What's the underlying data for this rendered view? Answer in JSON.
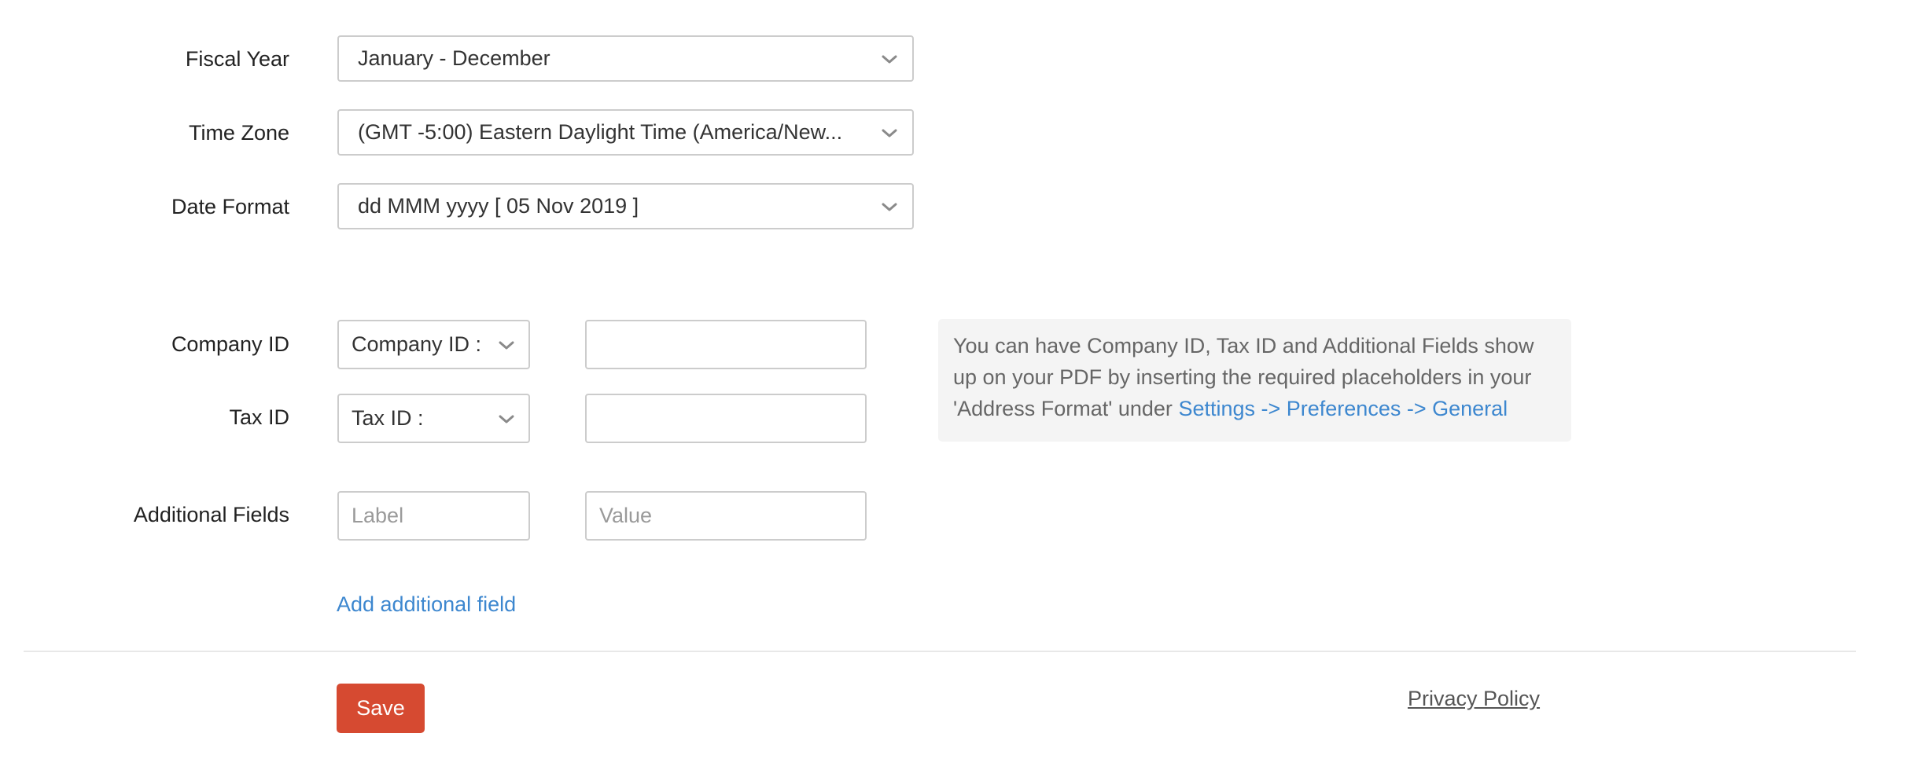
{
  "settings": {
    "fiscal_year": {
      "label": "Fiscal Year",
      "value": "January - December"
    },
    "time_zone": {
      "label": "Time Zone",
      "value": "(GMT -5:00) Eastern Daylight Time (America/New..."
    },
    "date_format": {
      "label": "Date Format",
      "value": "dd MMM yyyy [ 05 Nov 2019 ]"
    }
  },
  "identifiers": {
    "company_id": {
      "label": "Company ID",
      "type_value": "Company ID :",
      "value": ""
    },
    "tax_id": {
      "label": "Tax ID",
      "type_value": "Tax ID :",
      "value": ""
    },
    "additional_fields": {
      "label": "Additional Fields",
      "label_placeholder": "Label",
      "value_placeholder": "Value"
    },
    "add_field_link": "Add additional field"
  },
  "info_box": {
    "text": "You can have Company ID, Tax ID and Additional Fields show up on your PDF by inserting the required placeholders in your 'Address Format' under ",
    "link": "Settings -> Preferences -> General"
  },
  "footer": {
    "save_label": "Save",
    "privacy_policy": "Privacy Policy"
  },
  "colors": {
    "primary_button": "#d64a31",
    "link": "#3d87cf",
    "info_background": "#f4f4f4"
  },
  "icons": {
    "dropdown": "chevron-down-icon"
  }
}
